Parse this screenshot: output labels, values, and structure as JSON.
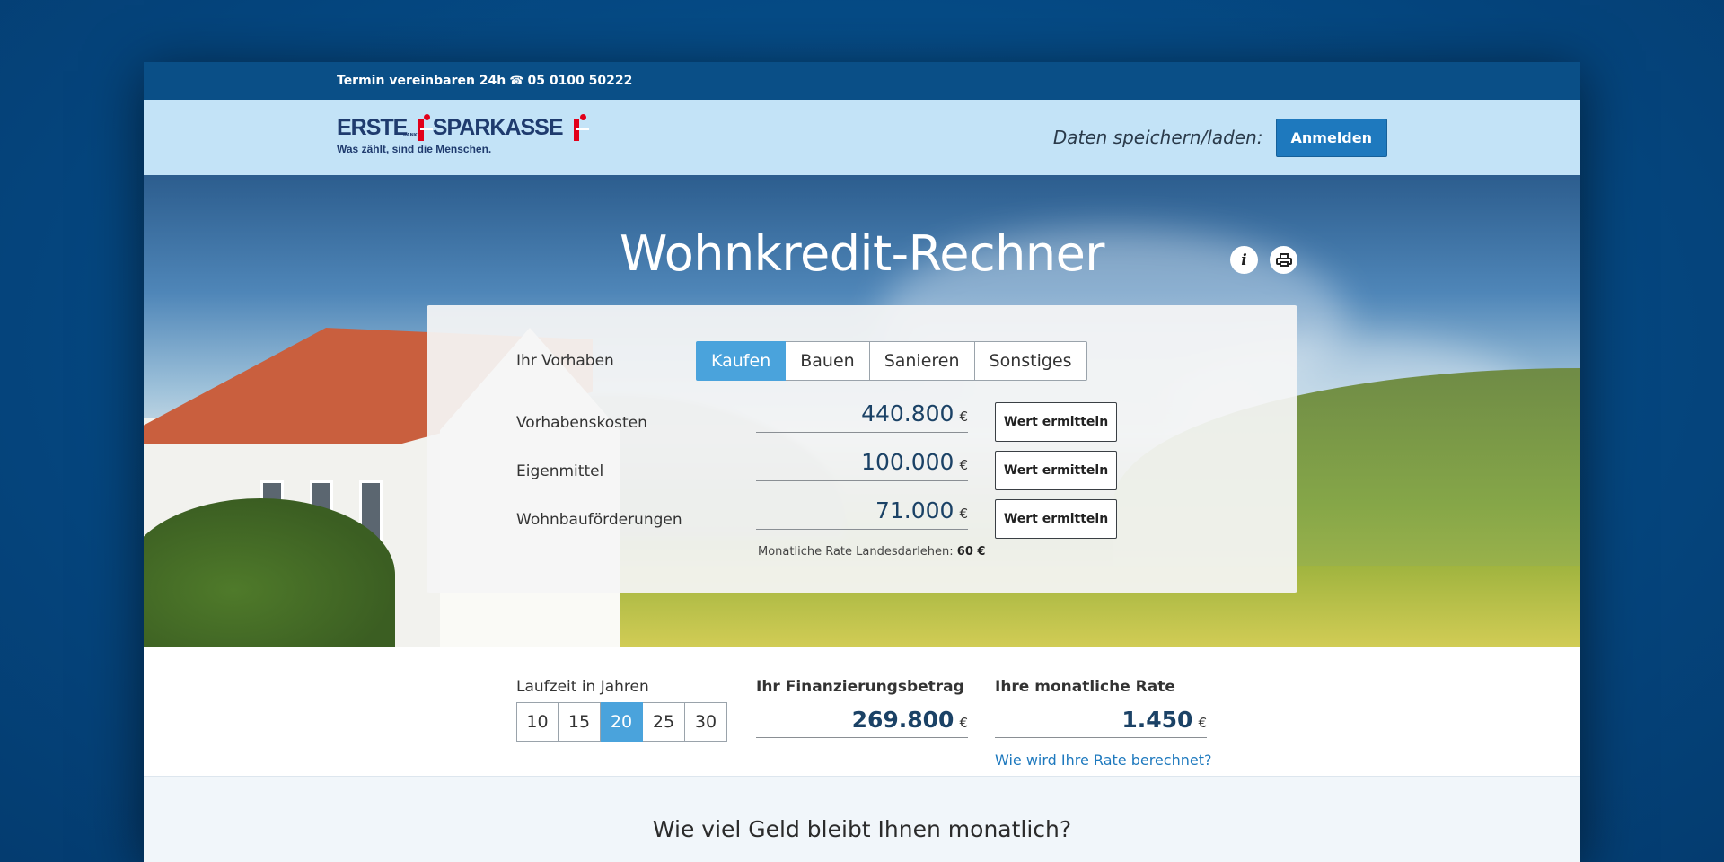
{
  "topbar": {
    "appointment_text": "Termin vereinbaren 24h",
    "phone_icon": "phone-icon",
    "phone": "05 0100 50222"
  },
  "header": {
    "logo": {
      "word1": "ERSTE",
      "bank": "BANK",
      "word2": "SPARKASSE",
      "tagline": "Was zählt, sind die Menschen."
    },
    "save_label": "Daten speichern/laden:",
    "login_button": "Anmelden"
  },
  "hero": {
    "title": "Wohnkredit-Rechner",
    "info_icon": "info-icon",
    "print_icon": "print-icon"
  },
  "form": {
    "purpose_label": "Ihr Vorhaben",
    "purpose_options": [
      "Kaufen",
      "Bauen",
      "Sanieren",
      "Sonstiges"
    ],
    "purpose_selected": "Kaufen",
    "fields": [
      {
        "label": "Vorhabenskosten",
        "value": "440.800",
        "currency": "€",
        "button": "Wert ermitteln"
      },
      {
        "label": "Eigenmittel",
        "value": "100.000",
        "currency": "€",
        "button": "Wert ermitteln"
      },
      {
        "label": "Wohnbauförderungen",
        "value": "71.000",
        "currency": "€",
        "button": "Wert ermitteln"
      }
    ],
    "note_text": "Monatliche Rate Landesdarlehen:",
    "note_value": "60 €"
  },
  "summary": {
    "term_label": "Laufzeit in Jahren",
    "term_options": [
      "10",
      "15",
      "20",
      "25",
      "30"
    ],
    "term_selected": "20",
    "financing_label": "Ihr Finanzierungsbetrag",
    "financing_value": "269.800",
    "monthly_label": "Ihre monatliche Rate",
    "monthly_value": "1.450",
    "currency": "€",
    "rate_link": "Wie wird Ihre Rate berechnet?"
  },
  "section2": {
    "title": "Wie viel Geld bleibt Ihnen monatlich?"
  },
  "colors": {
    "accent": "#4aa3dc",
    "brand_dark": "#0a4f87",
    "header_bg": "#c3e3f7",
    "button_blue": "#1e79be"
  }
}
